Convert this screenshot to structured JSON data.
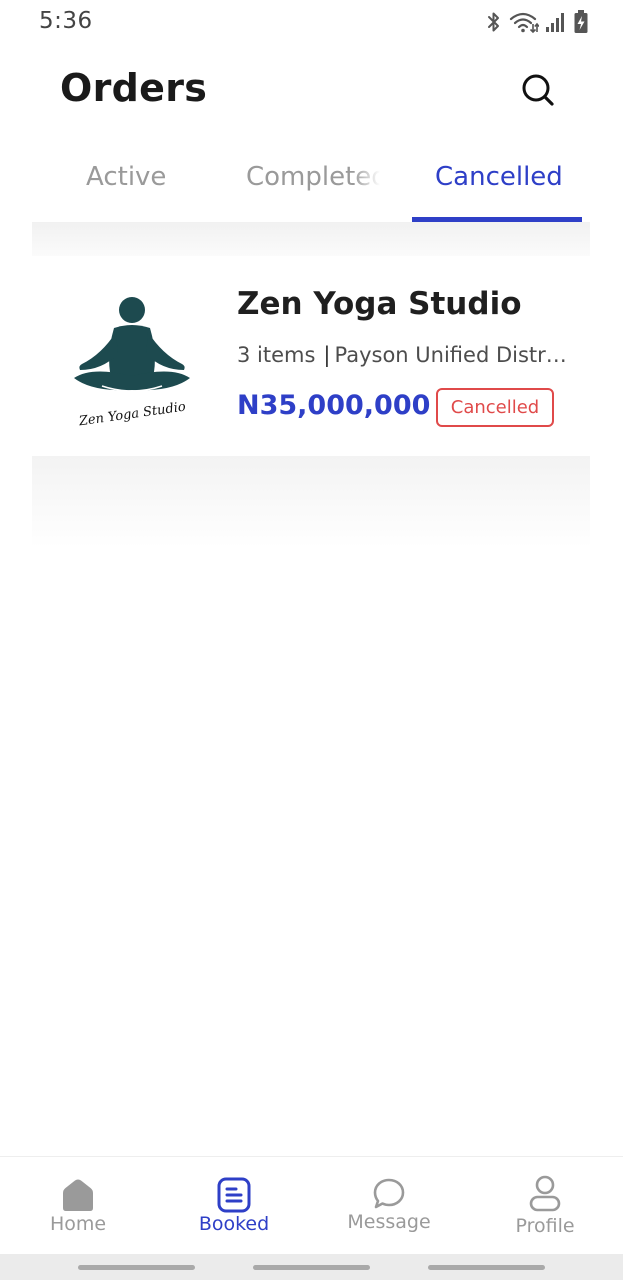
{
  "status_bar": {
    "time": "5:36",
    "icons": [
      "bluetooth-icon",
      "wifi-icon",
      "signal-icon",
      "battery-charging-icon"
    ]
  },
  "header": {
    "title": "Orders",
    "search_icon": "search-icon"
  },
  "tabs": [
    {
      "label": "Active",
      "active": false
    },
    {
      "label": "Completed",
      "active": false
    },
    {
      "label": "Cancelled",
      "active": true
    }
  ],
  "orders": [
    {
      "logo": "zen-yoga-studio-logo",
      "logo_text": "Zen Yoga Studio",
      "title": "Zen Yoga Studio",
      "items": "3 items",
      "separator": "|",
      "location": "Payson Unified District",
      "price": "N35,000,000",
      "status": "Cancelled"
    }
  ],
  "bottom_nav": [
    {
      "label": "Home",
      "icon": "home-icon",
      "active": false
    },
    {
      "label": "Booked",
      "icon": "booked-icon",
      "active": true
    },
    {
      "label": "Message",
      "icon": "message-icon",
      "active": false
    },
    {
      "label": "Profile",
      "icon": "profile-icon",
      "active": false
    }
  ],
  "colors": {
    "accent": "#2e3fc7",
    "inactive": "#9a9a9a",
    "cancelled": "#e04a4a",
    "logo": "#1d4a4f",
    "title": "#1a1a1a"
  }
}
